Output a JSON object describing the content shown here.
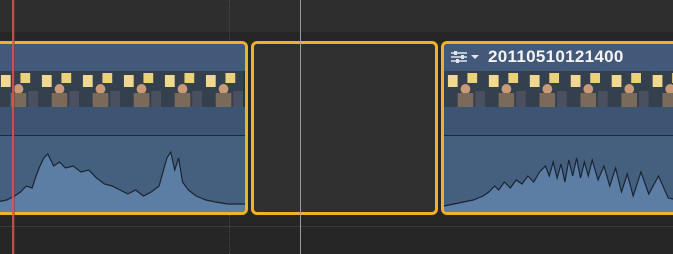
{
  "timeline": {
    "clips": [
      {
        "name": "",
        "selected": true
      },
      {
        "name": "20110510121400",
        "selected": false
      }
    ],
    "gap": {
      "selected": true
    }
  },
  "icons": {
    "clip_menu": "sliders-icon",
    "clip_menu_chevron": "chevron-down-icon"
  },
  "colors": {
    "selection": "#f0b22a",
    "clip": "#3d5473",
    "audio": "#45607f",
    "playhead": "#d9534f",
    "skimmer": "#9a9a9a"
  }
}
